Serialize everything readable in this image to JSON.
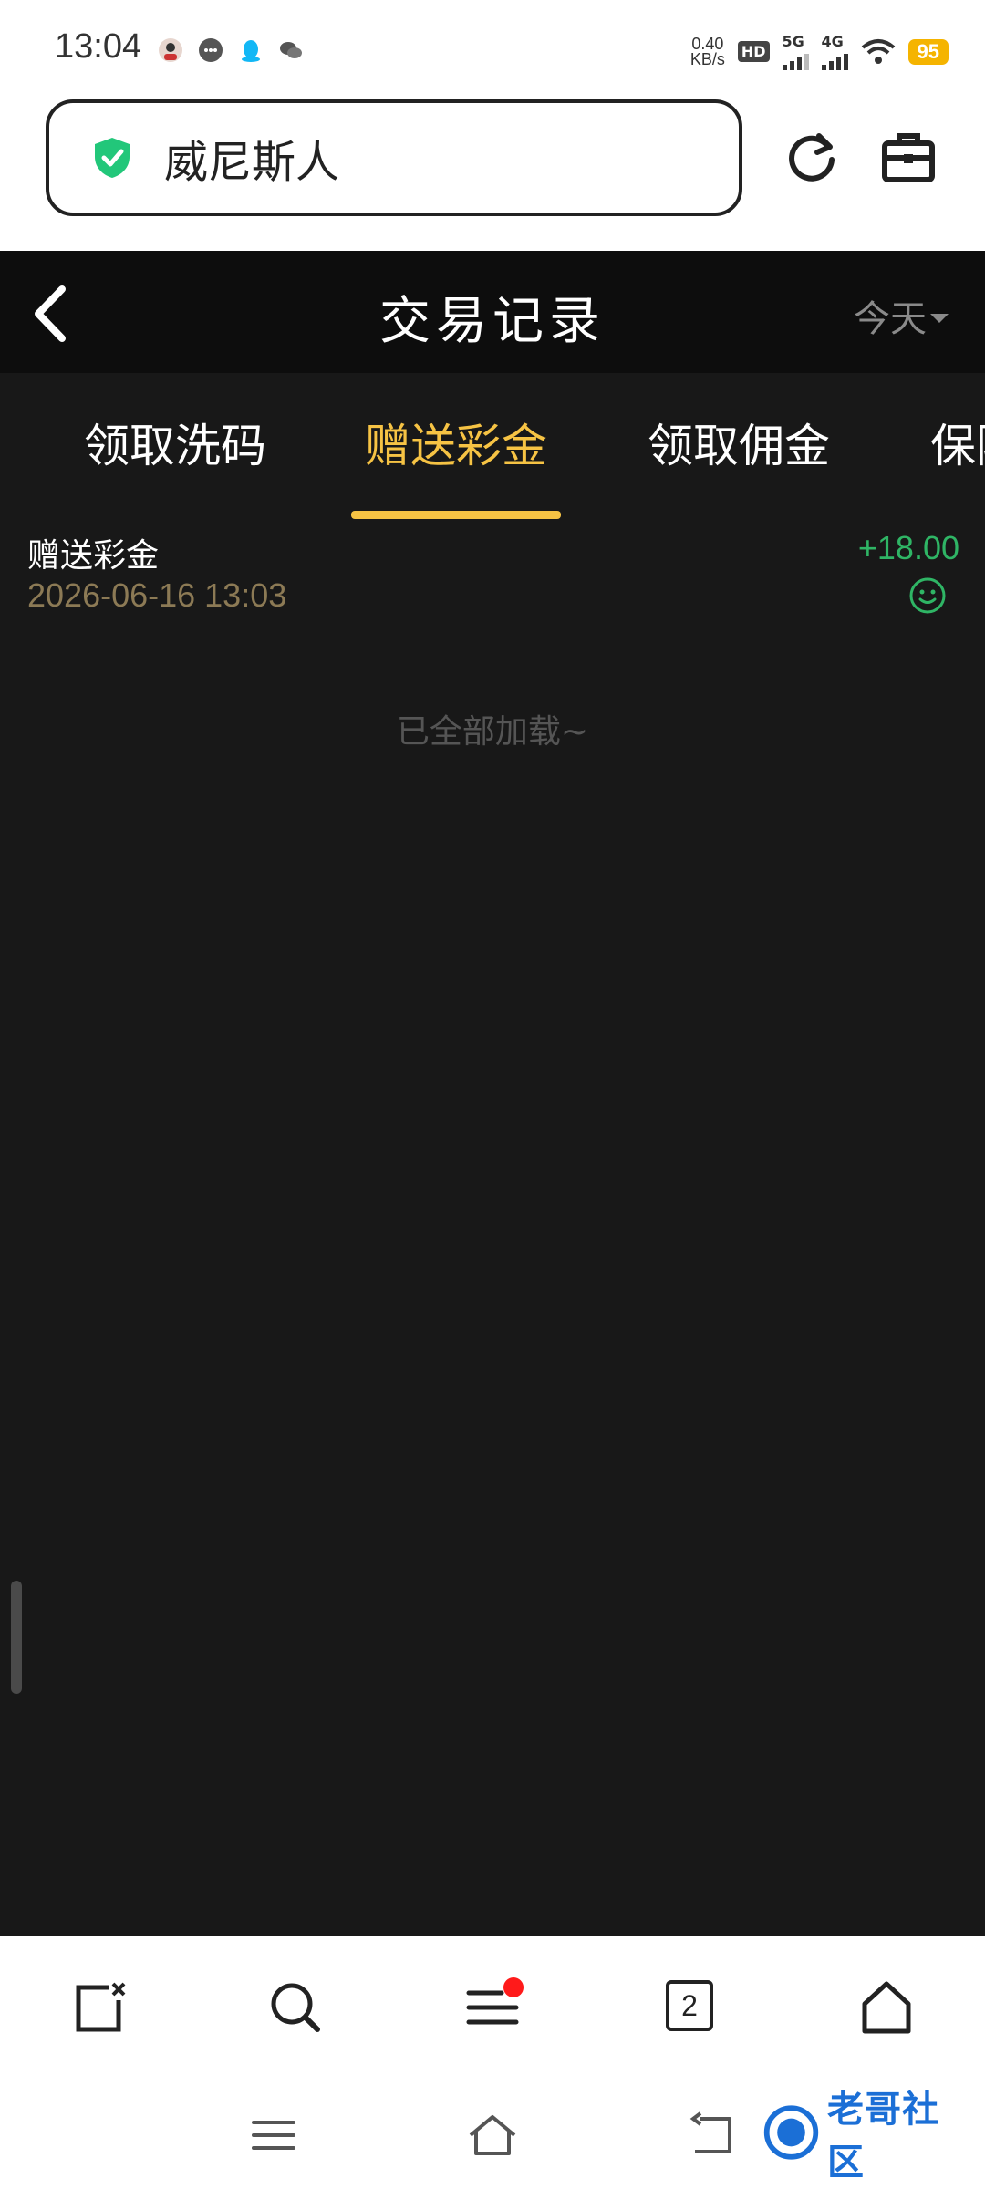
{
  "status_bar": {
    "time": "13:04",
    "net_speed_value": "0.40",
    "net_speed_unit": "KB/s",
    "hd_label": "HD",
    "sim1_label": "5G",
    "sim2_label": "4G",
    "battery": "95",
    "battery_color": "#f5b400"
  },
  "browser": {
    "url_title": "威尼斯人",
    "secure_icon": "shield-check-icon",
    "secure_color": "#22c77a"
  },
  "header": {
    "title": "交易记录",
    "date_filter": "今天"
  },
  "tabs": [
    {
      "label": "领取洗码",
      "active": false
    },
    {
      "label": "赠送彩金",
      "active": true
    },
    {
      "label": "领取佣金",
      "active": false
    },
    {
      "label": "保险",
      "active": false
    }
  ],
  "accent_color": "#f6c344",
  "records": [
    {
      "title": "赠送彩金",
      "time": "2026-06-16 13:03",
      "amount": "+18.00",
      "status_icon": "smile-icon"
    }
  ],
  "list_end_text": "已全部加载~",
  "toolbar": {
    "tab_count": "2"
  },
  "watermark": {
    "text": "老哥社区"
  }
}
